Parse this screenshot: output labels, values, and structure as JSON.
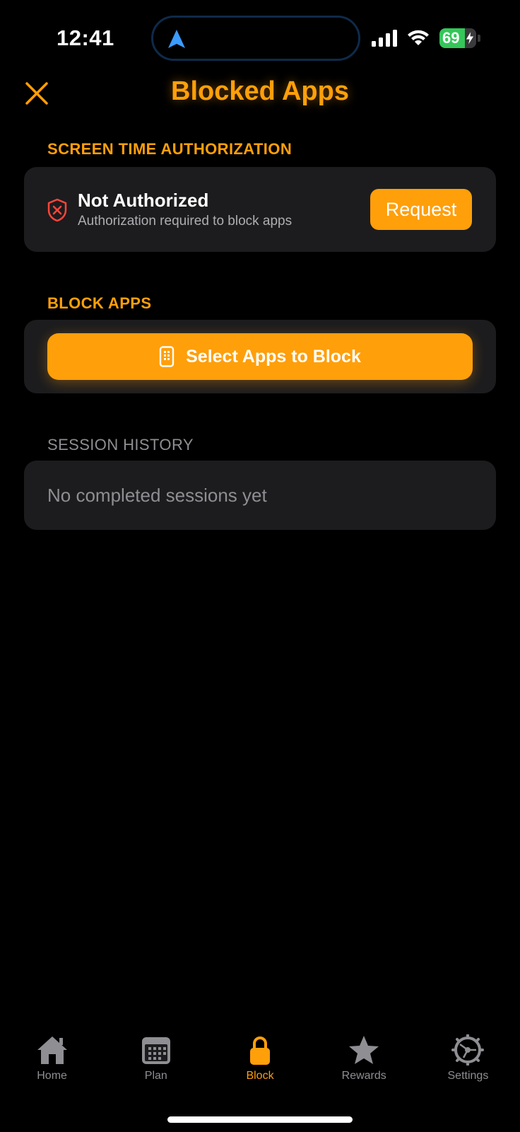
{
  "status_bar": {
    "time": "12:41",
    "battery_percent": "69",
    "battery_level": 0.69
  },
  "header": {
    "title": "Blocked Apps"
  },
  "authorization": {
    "section_label": "SCREEN TIME AUTHORIZATION",
    "status_title": "Not Authorized",
    "status_subtitle": "Authorization required to block apps",
    "request_label": "Request"
  },
  "block_apps": {
    "section_label": "BLOCK APPS",
    "select_label": "Select Apps to Block"
  },
  "session_history": {
    "section_label": "SESSION HISTORY",
    "empty_text": "No completed sessions yet"
  },
  "tabs": [
    {
      "label": "Home",
      "icon": "house-icon",
      "active": false
    },
    {
      "label": "Plan",
      "icon": "calendar-icon",
      "active": false
    },
    {
      "label": "Block",
      "icon": "lock-icon",
      "active": true
    },
    {
      "label": "Rewards",
      "icon": "star-icon",
      "active": false
    },
    {
      "label": "Settings",
      "icon": "gear-icon",
      "active": false
    }
  ],
  "colors": {
    "accent": "#ff9f0a",
    "background": "#000000",
    "card": "#1c1c1e",
    "muted": "#8e8e93",
    "danger": "#ff453a",
    "battery": "#34c759",
    "location": "#3b9bff"
  }
}
